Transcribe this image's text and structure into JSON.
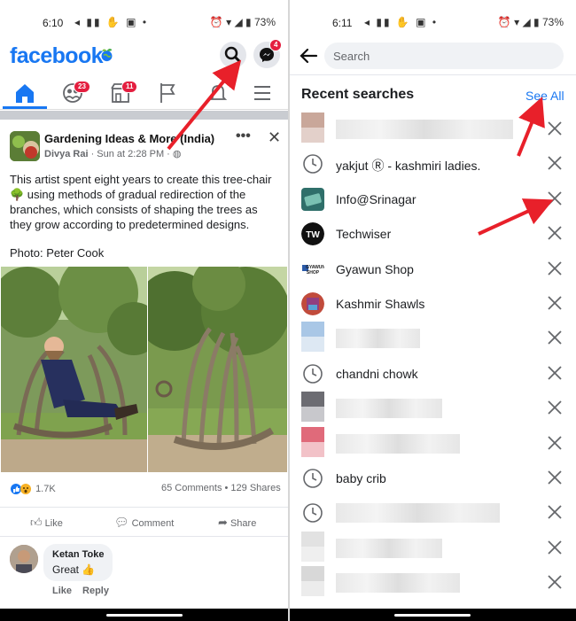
{
  "left": {
    "status": {
      "time": "6:10",
      "battery": "73%"
    },
    "header": {
      "logo": "facebook",
      "messenger_badge": "4"
    },
    "nav": {
      "friends_badge": "23",
      "market_badge": "11"
    },
    "post": {
      "group_name": "Gardening Ideas & More (India)",
      "author": "Divya Rai",
      "time": " · Sun at 2:28 PM · ",
      "text_part1": "This artist spent eight years to create this tree-chair ",
      "text_part2": " using methods of gradual redirection of the branches, which consists of shaping the trees as they grow according to predetermined designs.",
      "credit": "Photo: Peter Cook",
      "reactions_count": "1.7K",
      "comments_shares": "65 Comments • 129 Shares",
      "actions": {
        "like": "Like",
        "comment": "Comment",
        "share": "Share"
      }
    },
    "comment": {
      "name": "Ketan Toke",
      "text": "Great ",
      "like": "Like",
      "reply": "Reply"
    }
  },
  "right": {
    "status": {
      "time": "6:11",
      "battery": "73%"
    },
    "search": {
      "placeholder": "Search"
    },
    "title": "Recent searches",
    "see_all": "See All",
    "items": [
      {
        "label": "",
        "icon": "blurred-avatar"
      },
      {
        "label": "yakjut Ⓡ - kashmiri ladies.",
        "icon": "clock-icon"
      },
      {
        "label": "Info@Srinagar",
        "icon": "page-avatar"
      },
      {
        "label": "Techwiser",
        "icon": "techwiser-logo"
      },
      {
        "label": "Gyawun Shop",
        "icon": "shop-logo"
      },
      {
        "label": "Kashmir Shawls",
        "icon": "page-avatar"
      },
      {
        "label": "",
        "icon": "blurred-avatar"
      },
      {
        "label": "chandni chowk",
        "icon": "clock-icon"
      },
      {
        "label": "",
        "icon": "blurred-avatar"
      },
      {
        "label": "",
        "icon": "blurred-avatar"
      },
      {
        "label": "baby crib",
        "icon": "clock-icon"
      },
      {
        "label": "",
        "icon": "clock-icon"
      },
      {
        "label": "",
        "icon": "blurred-avatar"
      },
      {
        "label": "",
        "icon": "blurred-avatar"
      }
    ]
  },
  "colors": {
    "brand": "#1877f2",
    "badge": "#e41e3f",
    "annotation_arrow": "#e8202a"
  }
}
